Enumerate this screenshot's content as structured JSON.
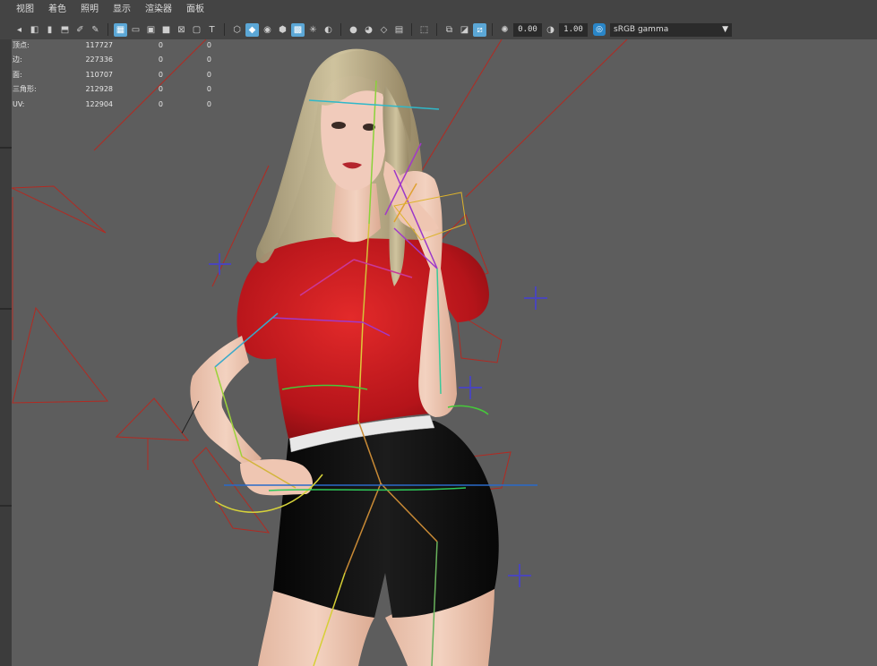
{
  "menu": [
    "视图",
    "着色",
    "照明",
    "显示",
    "渲染器",
    "面板"
  ],
  "toolbar": {
    "exposure_value": "0.00",
    "gamma_value": "1.00",
    "color_space": "sRGB gamma"
  },
  "hud": {
    "rows": [
      {
        "label": "顶点:",
        "values": [
          "117727",
          "0",
          "0"
        ]
      },
      {
        "label": "边:",
        "values": [
          "227336",
          "0",
          "0"
        ]
      },
      {
        "label": "面:",
        "values": [
          "110707",
          "0",
          "0"
        ]
      },
      {
        "label": "三角形:",
        "values": [
          "212928",
          "0",
          "0"
        ]
      },
      {
        "label": "UV:",
        "values": [
          "122904",
          "0",
          "0"
        ]
      }
    ]
  },
  "colors": {
    "viewport_bg": "#5d5d5d",
    "panel_bg": "#444444",
    "accent": "#5ba7d6",
    "shirt_red": "#c8191c",
    "shorts_black": "#111111"
  }
}
